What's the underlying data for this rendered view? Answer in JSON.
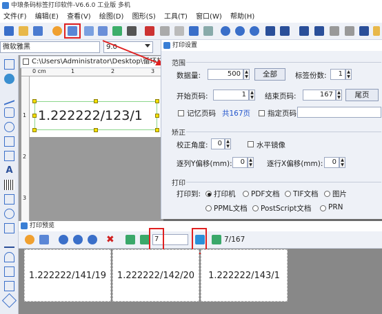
{
  "window": {
    "title": "中琅条码标签打印软件-V6.6.0 工业版 多机"
  },
  "menu": [
    "文件(F)",
    "编辑(E)",
    "查看(V)",
    "绘图(D)",
    "图形(S)",
    "工具(T)",
    "窗口(W)",
    "帮助(H)"
  ],
  "font_toolbar": {
    "font_name": "微软雅黑",
    "font_size": "9.0"
  },
  "document": {
    "tab_path": "C:\\Users\\Administrator\\Desktop\\循环打",
    "ruler_zero": "0 cm",
    "ruler_ticks": [
      "1",
      "2",
      "3"
    ],
    "vruler_ticks": [
      "1",
      "2",
      "3"
    ],
    "label_text": "1.222222/123/1"
  },
  "print_settings": {
    "title": "打印设置",
    "range": {
      "section": "范围",
      "data_qty_label": "数据量:",
      "data_qty_value": "500",
      "all_button": "全部",
      "copies_label": "标签份数:",
      "copies_value": "1",
      "start_page_label": "开始页码:",
      "start_page_value": "1",
      "end_page_label": "结束页码:",
      "end_page_value": "167",
      "last_page_button": "尾页",
      "remember_label": "记忆页码",
      "total_pages": "共167页",
      "specify_label": "指定页码"
    },
    "correct": {
      "section": "矫正",
      "angle_label": "校正角度:",
      "angle_value": "0",
      "mirror_label": "水平镜像",
      "y_offset_label": "逐列Y偏移(mm):",
      "y_offset_value": "0",
      "x_offset_label": "逐行X偏移(mm):",
      "x_offset_value": "0"
    },
    "print": {
      "section": "打印",
      "print_to_label": "打印到:",
      "options": [
        "打印机",
        "PDF文档",
        "TIF文档",
        "图片",
        "PPML文档",
        "PostScript文档",
        "PRN"
      ]
    }
  },
  "preview": {
    "title": "打印预览",
    "page_input": "7",
    "page_indicator": "7/167",
    "labels": [
      "1.222222/141/19",
      "1.222222/142/20",
      "1.222222/143/1"
    ]
  },
  "colors": {
    "accent": "#3a7fd5",
    "highlight": "#e02020",
    "link": "#2255cc"
  }
}
